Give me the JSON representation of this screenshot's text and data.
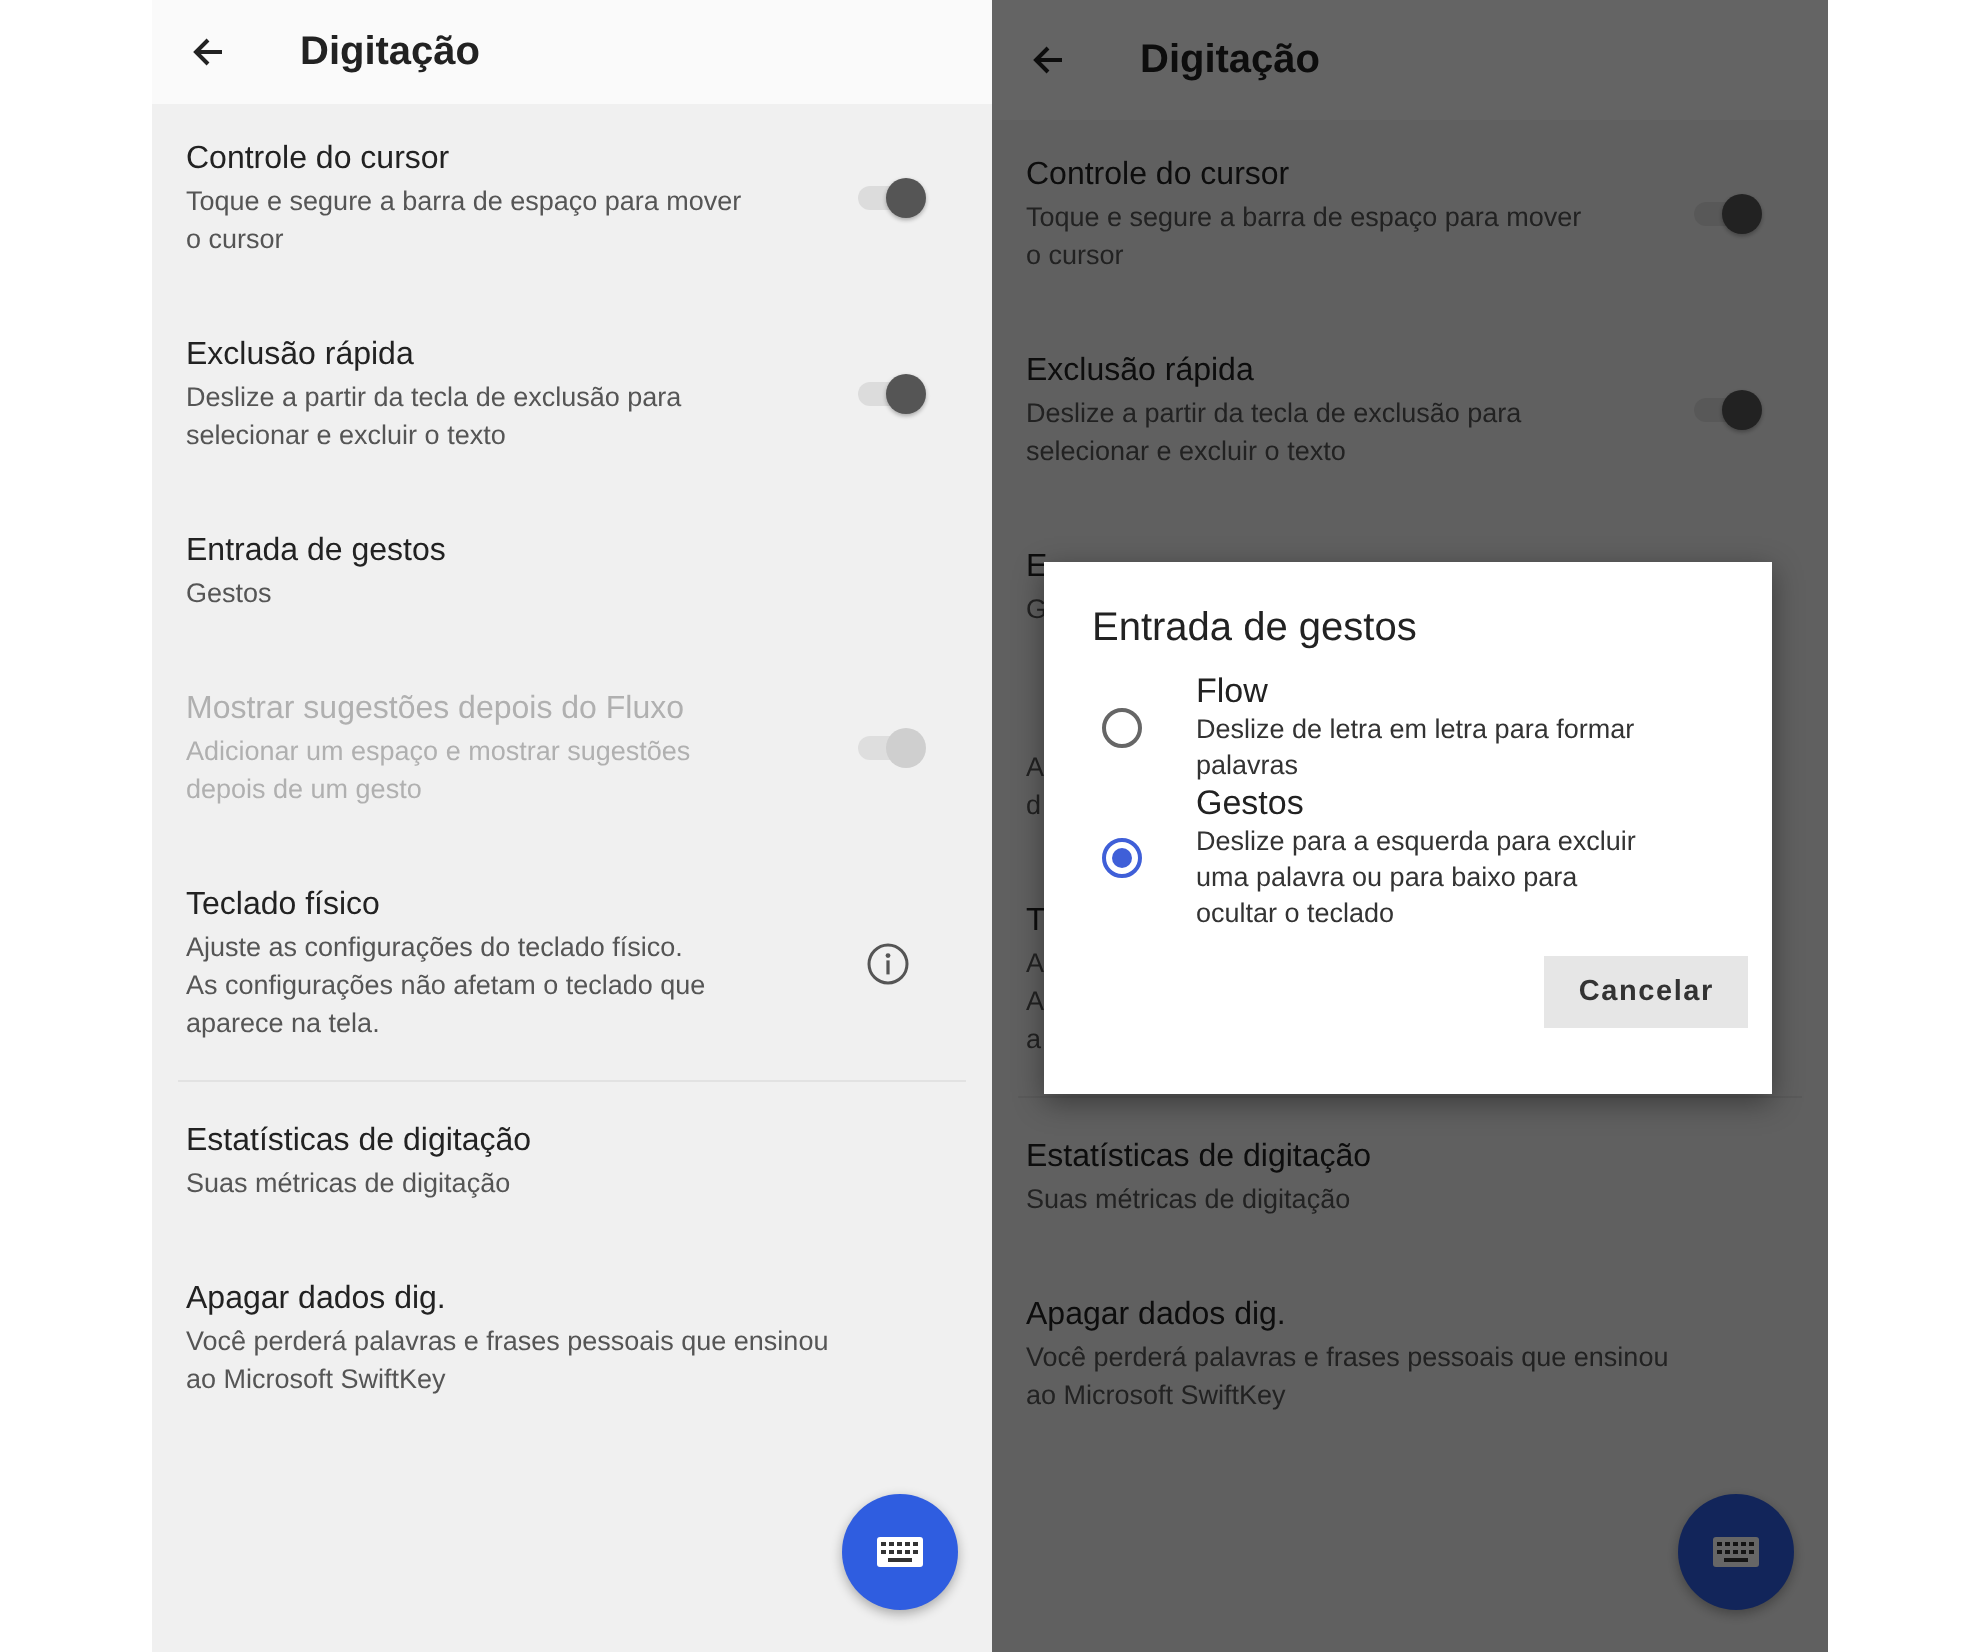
{
  "left_screen": {
    "header": {
      "title": "Digitação"
    },
    "items": [
      {
        "kind": "toggle",
        "title": "Controle do cursor",
        "description": "Toque e segure a barra de espaço para mover\no cursor",
        "on": true,
        "disabled": false
      },
      {
        "kind": "toggle",
        "title": "Exclusão rápida",
        "description": "Deslize a partir da tecla de exclusão para\nselecionar e excluir o texto",
        "on": true,
        "disabled": false
      },
      {
        "kind": "value",
        "title": "Entrada de gestos",
        "description": "Gestos"
      },
      {
        "kind": "toggle",
        "title": "Mostrar sugestões depois do Fluxo",
        "description": "Adicionar um espaço e mostrar sugestões\ndepois de um gesto",
        "on": true,
        "disabled": true
      },
      {
        "kind": "info",
        "title": "Teclado físico",
        "description": "Ajuste as configurações do teclado físico.\nAs configurações não afetam o teclado que\naparece na tela."
      },
      {
        "kind": "value",
        "title": "Estatísticas de digitação",
        "description": "Suas métricas de digitação",
        "section_start": true
      },
      {
        "kind": "value",
        "title": "Apagar dados dig.",
        "description": "Você perderá palavras e frases pessoais que ensinou\nao Microsoft SwiftKey"
      }
    ]
  },
  "right_screen": {
    "header": {
      "title": "Digitação"
    },
    "items": [
      {
        "kind": "toggle",
        "title": "Controle do cursor",
        "description": "Toque e segure a barra de espaço para mover\no cursor",
        "on": true,
        "disabled": false
      },
      {
        "kind": "toggle",
        "title": "Exclusão rápida",
        "description": "Deslize a partir da tecla de exclusão para\nselecionar e excluir o texto",
        "on": true,
        "disabled": false
      },
      {
        "kind": "covered",
        "title": "E",
        "lines": [
          "G"
        ]
      },
      {
        "kind": "covered",
        "lines": [
          "A",
          "d"
        ]
      },
      {
        "kind": "covered",
        "title": "T",
        "lines": [
          "A",
          "A",
          "a"
        ]
      },
      {
        "kind": "value",
        "title": "Estatísticas de digitação",
        "description": "Suas métricas de digitação",
        "section_start": true
      },
      {
        "kind": "value",
        "title": "Apagar dados dig.",
        "description": "Você perderá palavras e frases pessoais que ensinou\nao Microsoft SwiftKey"
      }
    ],
    "dialog": {
      "title": "Entrada de gestos",
      "options": [
        {
          "label": "Flow",
          "description": "Deslize de letra em letra para formar\npalavras",
          "selected": false
        },
        {
          "label": "Gestos",
          "description": "Deslize para a esquerda para excluir\numa palavra ou para baixo para\nocultar o teclado",
          "selected": true
        }
      ],
      "button": "Cancelar"
    }
  }
}
